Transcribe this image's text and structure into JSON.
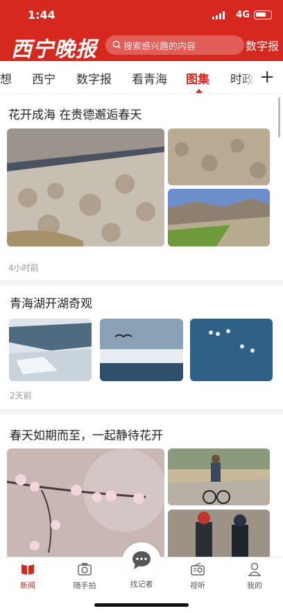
{
  "status": {
    "time": "1:44",
    "network": "4G"
  },
  "header": {
    "logo": "西宁晚报",
    "search_placeholder": "搜索感兴趣的内容",
    "digital_label": "数字报"
  },
  "tabs": [
    "想",
    "西宁",
    "数字报",
    "看青海",
    "图集",
    "时政"
  ],
  "active_tab": "图集",
  "posts": [
    {
      "title": "花开成海 在贵德邂逅春天",
      "time": "4小时前"
    },
    {
      "title": "青海湖开湖奇观",
      "time": "2天前"
    },
    {
      "title": "春天如期而至，一起静待花开"
    }
  ],
  "tabbar": [
    {
      "label": "新闻",
      "icon": "news-book-icon",
      "active": true
    },
    {
      "label": "随手拍",
      "icon": "camera-icon"
    },
    {
      "label": "找记者",
      "icon": "chat-bubble-icon"
    },
    {
      "label": "视听",
      "icon": "radio-icon"
    },
    {
      "label": "我的",
      "icon": "person-icon"
    }
  ],
  "colors": {
    "brand": "#d6281f"
  }
}
